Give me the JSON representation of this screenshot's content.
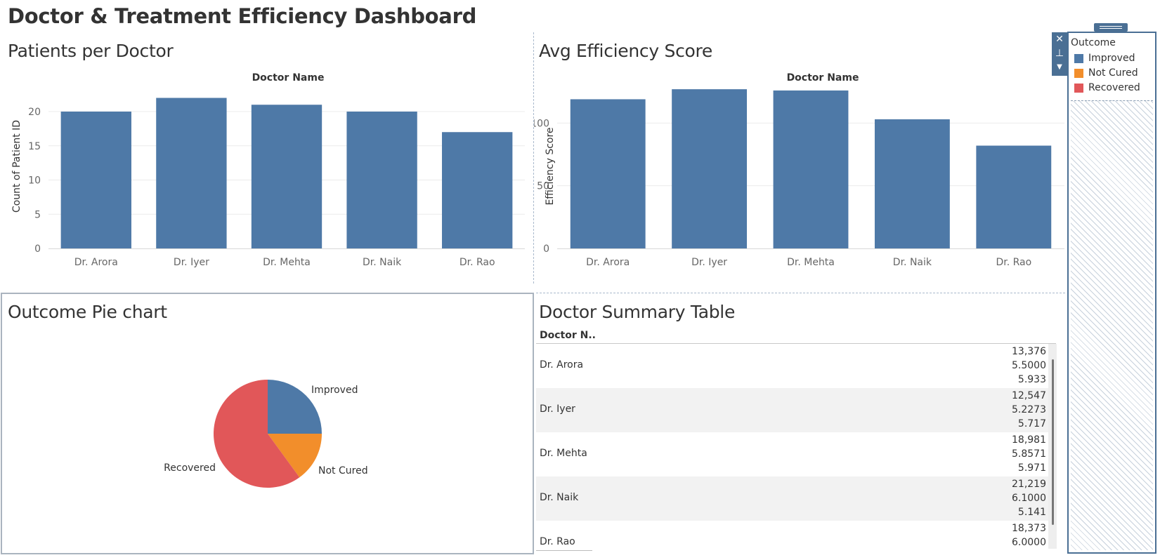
{
  "dashboard": {
    "title": "Doctor & Treatment Efficiency Dashboard"
  },
  "colors": {
    "improved": "#4e79a7",
    "not_cured": "#f28e2b",
    "recovered": "#e15759",
    "bar": "#4e79a7",
    "accent": "#4a6f94"
  },
  "panels": {
    "patients": {
      "title": "Patients per Doctor",
      "column_header": "Doctor Name"
    },
    "efficiency": {
      "title": "Avg Efficiency Score",
      "column_header": "Doctor Name"
    },
    "pie": {
      "title": "Outcome Pie chart"
    },
    "table": {
      "title": "Doctor Summary Table",
      "column_header": "Doctor N.."
    }
  },
  "legend": {
    "title": "Outcome",
    "items": [
      {
        "label": "Improved",
        "color": "#4e79a7"
      },
      {
        "label": "Not Cured",
        "color": "#f28e2b"
      },
      {
        "label": "Recovered",
        "color": "#e15759"
      }
    ]
  },
  "table": {
    "rows": [
      {
        "doctor": "Dr. Arora",
        "values": [
          "13,376",
          "5.5000",
          "5.933"
        ]
      },
      {
        "doctor": "Dr. Iyer",
        "values": [
          "12,547",
          "5.2273",
          "5.717"
        ]
      },
      {
        "doctor": "Dr. Mehta",
        "values": [
          "18,981",
          "5.8571",
          "5.971"
        ]
      },
      {
        "doctor": "Dr. Naik",
        "values": [
          "21,219",
          "6.1000",
          "5.141"
        ]
      },
      {
        "doctor": "Dr. Rao",
        "values": [
          "18,373",
          "6.0000"
        ]
      }
    ]
  },
  "chart_data": [
    {
      "type": "bar",
      "title": "Patients per Doctor",
      "column_header": "Doctor Name",
      "categories": [
        "Dr. Arora",
        "Dr. Iyer",
        "Dr. Mehta",
        "Dr. Naik",
        "Dr. Rao"
      ],
      "values": [
        20,
        22,
        21,
        20,
        17
      ],
      "ylabel": "Count of Patient ID",
      "ylim": [
        0,
        24
      ],
      "yticks": [
        0,
        5,
        10,
        15,
        20
      ],
      "grid": true
    },
    {
      "type": "bar",
      "title": "Avg Efficiency Score",
      "column_header": "Doctor Name",
      "categories": [
        "Dr. Arora",
        "Dr. Iyer",
        "Dr. Mehta",
        "Dr. Naik",
        "Dr. Rao"
      ],
      "values": [
        119,
        127,
        126,
        103,
        82
      ],
      "ylabel": "Efficiency Score",
      "ylim": [
        0,
        131
      ],
      "yticks": [
        0,
        50,
        100
      ],
      "grid": true
    },
    {
      "type": "pie",
      "title": "Outcome Pie chart",
      "labels": [
        "Improved",
        "Not Cured",
        "Recovered"
      ],
      "values": [
        25,
        15,
        60
      ],
      "colors": [
        "#4e79a7",
        "#f28e2b",
        "#e15759"
      ]
    }
  ]
}
